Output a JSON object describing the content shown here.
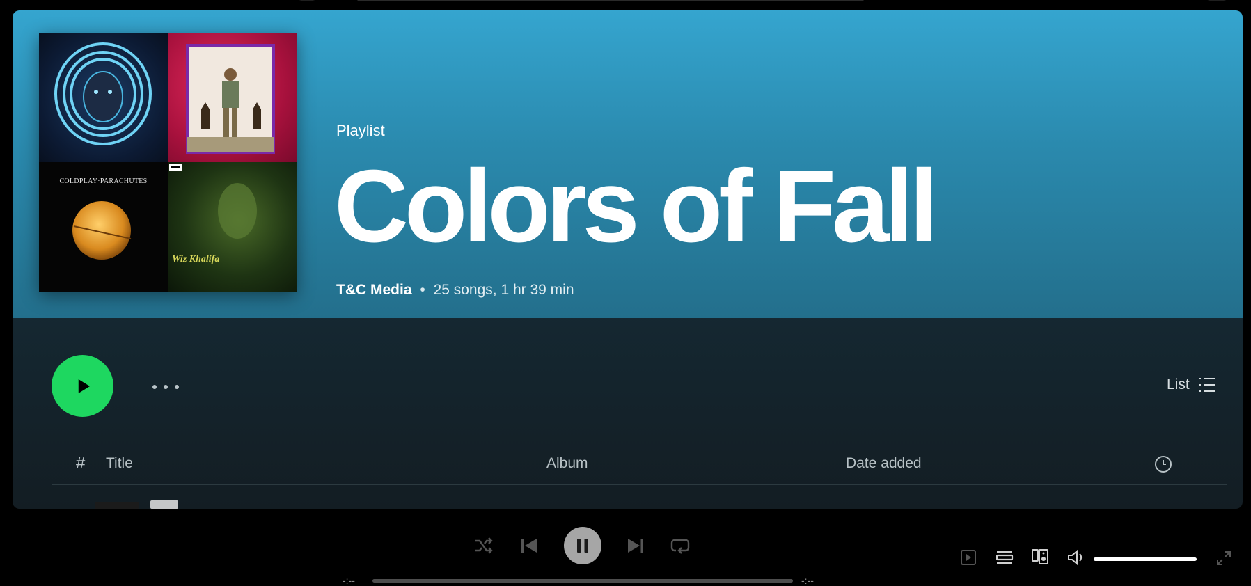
{
  "playlist": {
    "kind": "Playlist",
    "title": "Colors of Fall",
    "owner": "T&C Media",
    "separator": "•",
    "stats": "25 songs, 1 hr 39 min"
  },
  "cover": {
    "tile3_text": "COLDPLAY·PARACHUTES",
    "tile4_text": "Wiz Khalifa"
  },
  "actions": {
    "view_label": "List"
  },
  "table": {
    "headers": {
      "number": "#",
      "title": "Title",
      "album": "Album",
      "date_added": "Date added"
    }
  },
  "player": {
    "elapsed": "-:--",
    "remaining": "-:--",
    "progress_fraction": 0,
    "volume_fraction": 1.0
  },
  "colors": {
    "accent": "#1ed760",
    "hero_top": "#35a5cf"
  }
}
